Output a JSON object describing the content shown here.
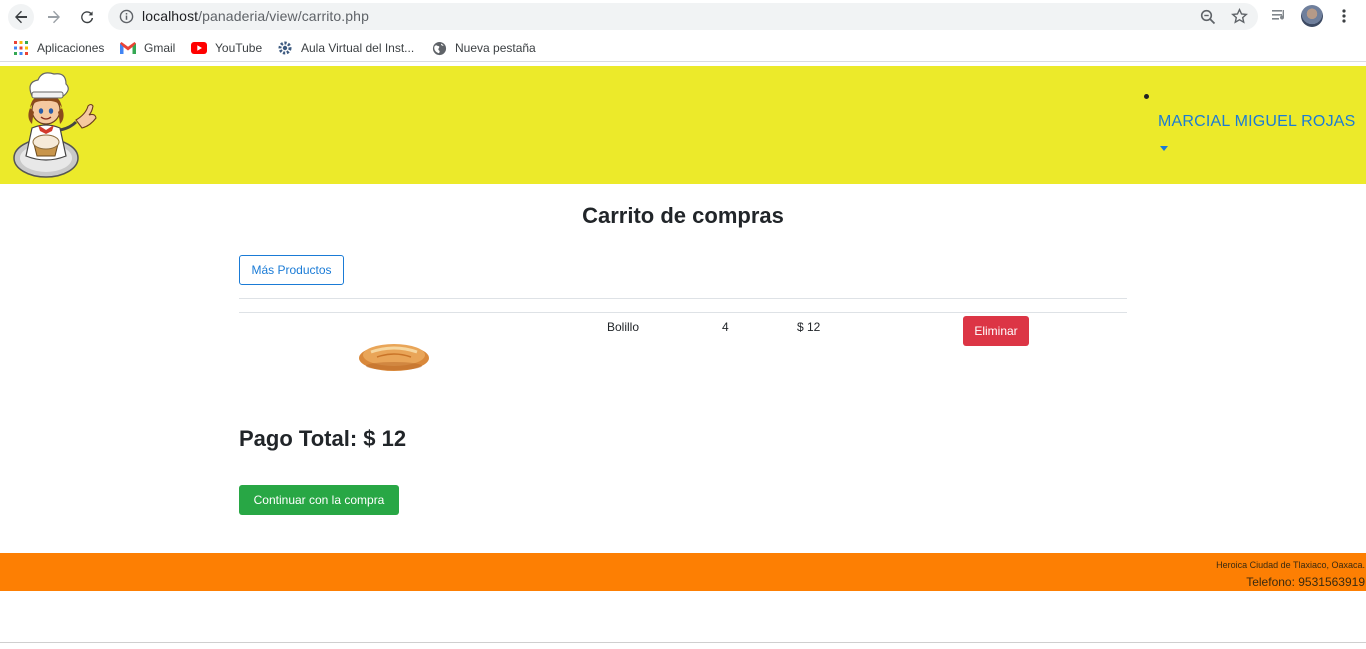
{
  "browser": {
    "url_host": "localhost",
    "url_path": "/panaderia/view/carrito.php",
    "bookmarks": [
      {
        "label": "Aplicaciones",
        "icon": "apps-grid-icon"
      },
      {
        "label": "Gmail",
        "icon": "gmail-icon"
      },
      {
        "label": "YouTube",
        "icon": "youtube-icon"
      },
      {
        "label": "Aula Virtual del Inst...",
        "icon": "gear-logo-icon"
      },
      {
        "label": "Nueva pestaña",
        "icon": "globe-icon"
      }
    ]
  },
  "header": {
    "user_name": "MARCIAL MIGUEL ROJAS",
    "background": "#ecea2a",
    "user_color": "#1a7bd6"
  },
  "cart": {
    "title": "Carrito de compras",
    "more_products_label": "Más Productos",
    "items": [
      {
        "name": "Bolillo",
        "quantity": "4",
        "price": "$ 12",
        "remove_label": "Eliminar",
        "image_icon": "bread-icon"
      }
    ],
    "total_label": "Pago Total: $ 12",
    "continue_label": "Continuar con la compra"
  },
  "footer": {
    "city": "Heroica Ciudad de Tlaxiaco, Oaxaca.",
    "phone": "Telefono: 9531563919",
    "background": "#fd7f03"
  },
  "colors": {
    "danger": "#dc3545",
    "success": "#28a745",
    "primary": "#1a7bd6"
  }
}
